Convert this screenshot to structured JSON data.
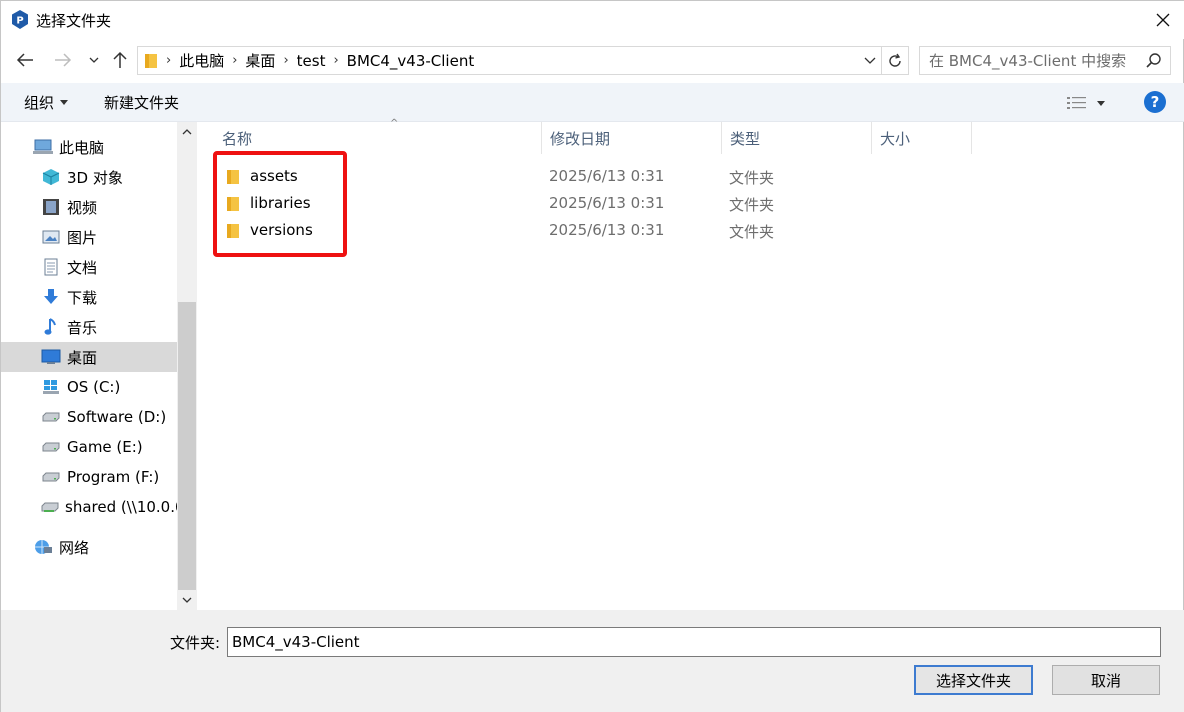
{
  "window": {
    "title": "选择文件夹"
  },
  "address": {
    "segments": [
      "此电脑",
      "桌面",
      "test",
      "BMC4_v43-Client"
    ]
  },
  "search": {
    "placeholder": "在 BMC4_v43-Client 中搜索"
  },
  "toolbar": {
    "organize_label": "组织",
    "new_folder_label": "新建文件夹",
    "help_label": "?"
  },
  "sidebar": {
    "items": [
      {
        "label": "此电脑",
        "icon": "computer-icon"
      },
      {
        "label": "3D 对象",
        "icon": "3d-objects-icon"
      },
      {
        "label": "视频",
        "icon": "video-icon"
      },
      {
        "label": "图片",
        "icon": "pictures-icon"
      },
      {
        "label": "文档",
        "icon": "documents-icon"
      },
      {
        "label": "下载",
        "icon": "download-icon"
      },
      {
        "label": "音乐",
        "icon": "music-icon"
      },
      {
        "label": "桌面",
        "icon": "desktop-icon",
        "selected": true
      },
      {
        "label": "OS (C:)",
        "icon": "windows-drive-icon"
      },
      {
        "label": "Software (D:)",
        "icon": "drive-icon"
      },
      {
        "label": "Game (E:)",
        "icon": "drive-icon"
      },
      {
        "label": "Program (F:)",
        "icon": "drive-icon"
      },
      {
        "label": "shared (\\\\10.0.0",
        "icon": "network-drive-icon"
      },
      {
        "label": "网络",
        "icon": "network-icon"
      }
    ]
  },
  "columns": {
    "name": "名称",
    "date": "修改日期",
    "type": "类型",
    "size": "大小"
  },
  "files": [
    {
      "name": "assets",
      "date": "2025/6/13 0:31",
      "type": "文件夹"
    },
    {
      "name": "libraries",
      "date": "2025/6/13 0:31",
      "type": "文件夹"
    },
    {
      "name": "versions",
      "date": "2025/6/13 0:31",
      "type": "文件夹"
    }
  ],
  "bottom": {
    "folder_label": "文件夹:",
    "folder_value": "BMC4_v43-Client",
    "select_button": "选择文件夹",
    "cancel_button": "取消"
  },
  "colors": {
    "accent": "#1b6fd1",
    "highlight": "#ee1111",
    "selected_bg": "#d9d9d9",
    "folder": "#f5c342"
  }
}
